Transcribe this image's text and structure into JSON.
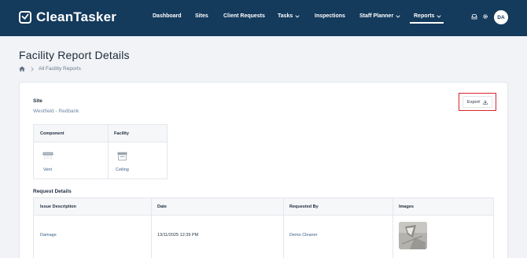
{
  "app": {
    "name": "CleanTasker"
  },
  "nav": {
    "items": [
      {
        "label": "Dashboard"
      },
      {
        "label": "Sites"
      },
      {
        "label": "Client Requests"
      },
      {
        "label": "Tasks"
      },
      {
        "label": "Inspections"
      },
      {
        "label": "Staff Planner"
      },
      {
        "label": "Reports"
      }
    ],
    "active": "Reports",
    "icons": [
      "inbox-icon",
      "gear-icon"
    ],
    "avatar_initials": "DA"
  },
  "page": {
    "title": "Facility Report Details",
    "breadcrumb": {
      "home_icon": "home-icon",
      "current": "All Facility Reports"
    }
  },
  "site": {
    "label": "Site",
    "value": "Westfield - Redbank"
  },
  "export": {
    "label": "Export",
    "icon": "download-icon",
    "highlight_color": "#d9262c"
  },
  "component_facility": {
    "headers": [
      "Component",
      "Facility"
    ],
    "values": [
      {
        "icon": "vent-icon",
        "label": "Vent"
      },
      {
        "icon": "ceiling-icon",
        "label": "Ceiling"
      }
    ]
  },
  "request_details": {
    "label": "Request Details",
    "columns": [
      "Issue Description",
      "Date",
      "Requested By",
      "Images"
    ],
    "rows": [
      {
        "issue": "Damage",
        "date": "13/11/2025 12:39 PM",
        "requested_by": "Demo Cleaner",
        "image": "damage-photo"
      }
    ]
  },
  "colors": {
    "nav_bg": "#143a5c",
    "accent_link": "#3a5f86",
    "page_bg": "#f1f3f6"
  }
}
